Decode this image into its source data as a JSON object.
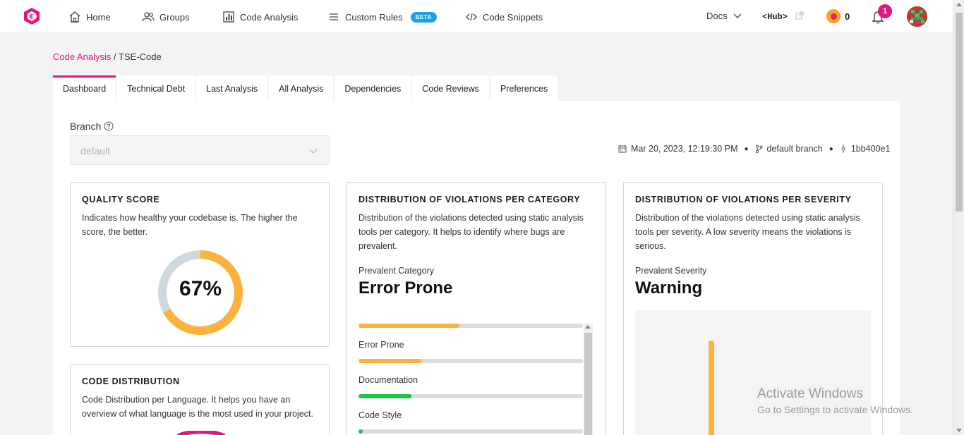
{
  "nav": {
    "items": [
      {
        "label": "Home"
      },
      {
        "label": "Groups"
      },
      {
        "label": "Code Analysis"
      },
      {
        "label": "Custom Rules"
      },
      {
        "label": "Code Snippets"
      }
    ],
    "beta_badge": "BETA",
    "docs": "Docs",
    "hub": "<Hub>",
    "coins": "0",
    "notifications": "1"
  },
  "breadcrumb": {
    "parent": "Code Analysis",
    "separator": "/",
    "current": "TSE-Code"
  },
  "tabs": [
    "Dashboard",
    "Technical Debt",
    "Last Analysis",
    "All Analysis",
    "Dependencies",
    "Code Reviews",
    "Preferences"
  ],
  "branch": {
    "label": "Branch",
    "value": "default"
  },
  "meta": {
    "date": "Mar 20, 2023, 12:19:30 PM",
    "branch": "default branch",
    "commit": "1bb400e1"
  },
  "quality": {
    "title": "QUALITY SCORE",
    "desc": "Indicates how healthy your codebase is. The higher the score, the better.",
    "score_label": "67%",
    "score": 0.67,
    "fill_color": "#fcb23d",
    "track_color": "#cfd8dc"
  },
  "code_dist": {
    "title": "CODE DISTRIBUTION",
    "desc": "Code Distribution per Language. It helps you have an overview of what language is the most used in your project."
  },
  "cat": {
    "title": "DISTRIBUTION OF VIOLATIONS PER CATEGORY",
    "desc": "Distribution of the violations detected using static analysis tools per category. It helps to identify where bugs are prevalent.",
    "prevalent_label": "Prevalent Category",
    "prevalent_value": "Error Prone",
    "bars": [
      {
        "label": "",
        "fraction": 0.45,
        "color": "#fcb23d"
      },
      {
        "label": "Error Prone",
        "fraction": 0.28,
        "color": "#fcb23d"
      },
      {
        "label": "Documentation",
        "fraction": 0.235,
        "color": "#1ec244"
      },
      {
        "label": "Code Style",
        "fraction": 0.02,
        "color": "#1ec244"
      }
    ]
  },
  "sev": {
    "title": "DISTRIBUTION OF VIOLATIONS PER SEVERITY",
    "desc": "Distribution of the violations detected using static analysis tools per severity. A low severity means the violations is serious.",
    "prevalent_label": "Prevalent Severity",
    "prevalent_value": "Warning"
  },
  "watermark": {
    "line1": "Activate Windows",
    "line2": "Go to Settings to activate Windows."
  },
  "colors": {
    "accent": "#e3157f",
    "warning": "#fcb23d",
    "success": "#1ec244",
    "beta": "#1aa3e8"
  }
}
